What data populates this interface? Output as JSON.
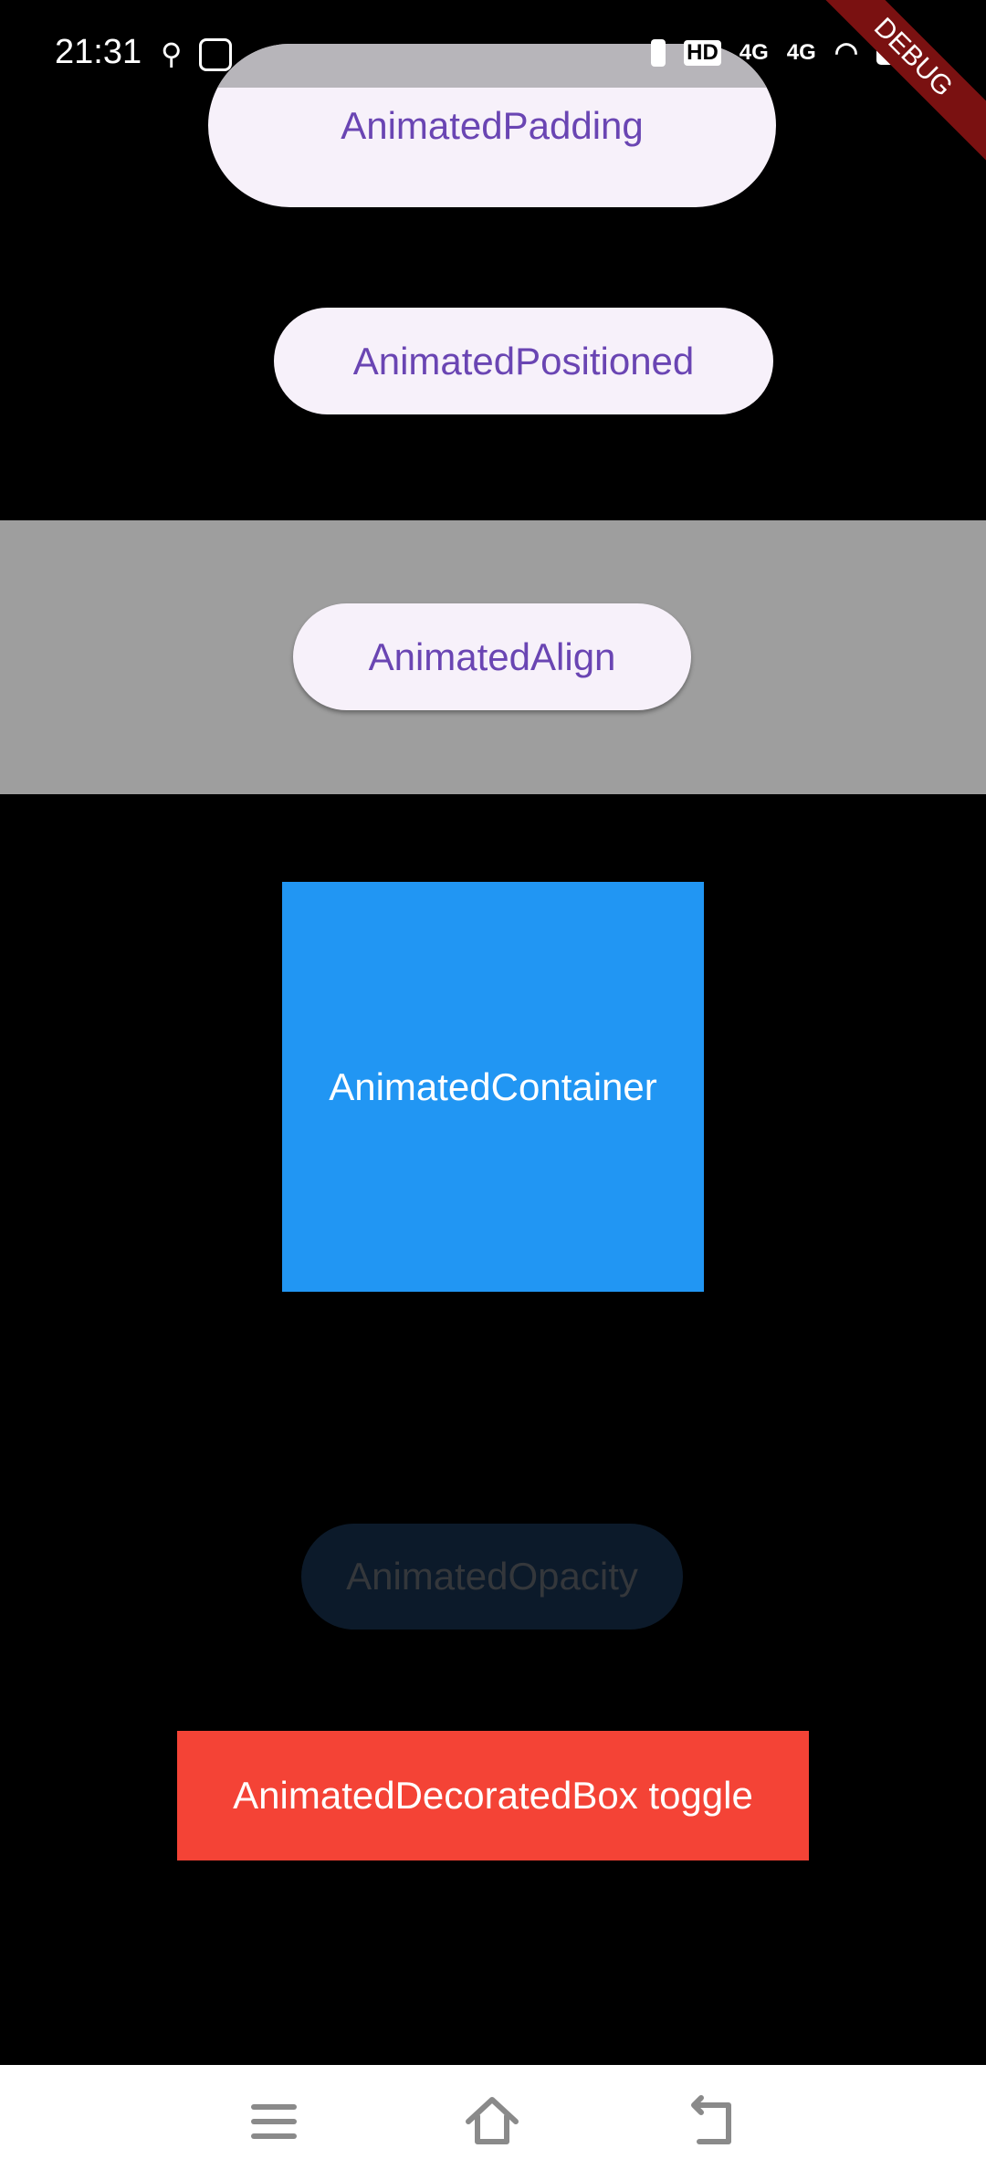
{
  "status_bar": {
    "time": "21:31",
    "network_1": "4G",
    "network_2": "4G",
    "hd": "HD"
  },
  "debug_banner": "DEBUG",
  "buttons": {
    "padding": "AnimatedPadding",
    "positioned": "AnimatedPositioned",
    "align": "AnimatedAlign",
    "container": "AnimatedContainer",
    "opacity": "AnimatedOpacity",
    "decorated": "AnimatedDecoratedBox toggle"
  },
  "colors": {
    "container": "#2196F3",
    "decorated": "#F44336",
    "align_band": "#9E9E9E",
    "button_text": "#6A45B3"
  },
  "nav": {
    "icons": [
      "menu-icon",
      "home-icon",
      "back-icon"
    ]
  }
}
